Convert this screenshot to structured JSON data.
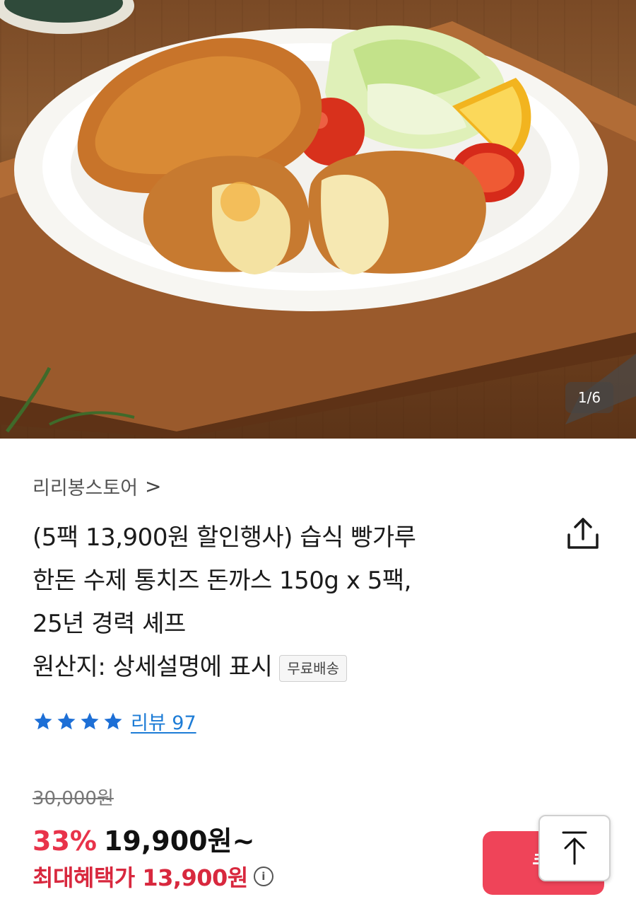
{
  "gallery": {
    "counter": "1/6",
    "image_icon": "product-photo-cheese-pork-cutlet"
  },
  "store": {
    "name": "리리봉스토어",
    "chevron": ">"
  },
  "product": {
    "title_lines": [
      "(5팩 13,900원 할인행사) 습식 빵가루",
      "한돈 수제 통치즈 돈까스 150g x 5팩,",
      "25년 경력 셰프",
      "원산지: 상세설명에 표시"
    ],
    "badge": "무료배송",
    "share_icon": "share-icon"
  },
  "rating": {
    "stars": 4,
    "star_color": "#1d6fd6",
    "review_label": "리뷰 97"
  },
  "price": {
    "original": "30,000원",
    "discount_rate": "33%",
    "sale_price": "19,900원~",
    "max_benefit_label": "최대혜택가 13,900원",
    "info_icon": "i",
    "accent_color": "#e8334a"
  },
  "actions": {
    "coupon_label": "쿠폰",
    "scroll_top_icon": "arrow-up-icon"
  }
}
